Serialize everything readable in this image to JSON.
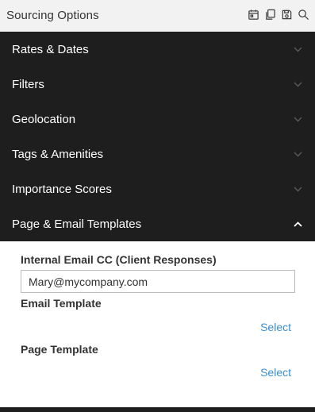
{
  "header": {
    "title": "Sourcing Options",
    "icons": [
      "calendar-icon",
      "copy-icon",
      "save-icon",
      "search-icon"
    ]
  },
  "accordion": {
    "items": [
      {
        "label": "Rates & Dates",
        "expanded": false
      },
      {
        "label": "Filters",
        "expanded": false
      },
      {
        "label": "Geolocation",
        "expanded": false
      },
      {
        "label": "Tags & Amenities",
        "expanded": false
      },
      {
        "label": "Importance Scores",
        "expanded": false
      },
      {
        "label": "Page & Email Templates",
        "expanded": true
      }
    ]
  },
  "templates": {
    "email_cc_label": "Internal Email CC (Client Responses)",
    "email_cc_value": "Mary@mycompany.com",
    "email_template_label": "Email Template",
    "email_template_select": "Select",
    "page_template_label": "Page Template",
    "page_template_select": "Select"
  },
  "colors": {
    "header_bg": "#f2f2f2",
    "accordion_bg": "#1e1e1e",
    "link": "#3b8fd0"
  }
}
